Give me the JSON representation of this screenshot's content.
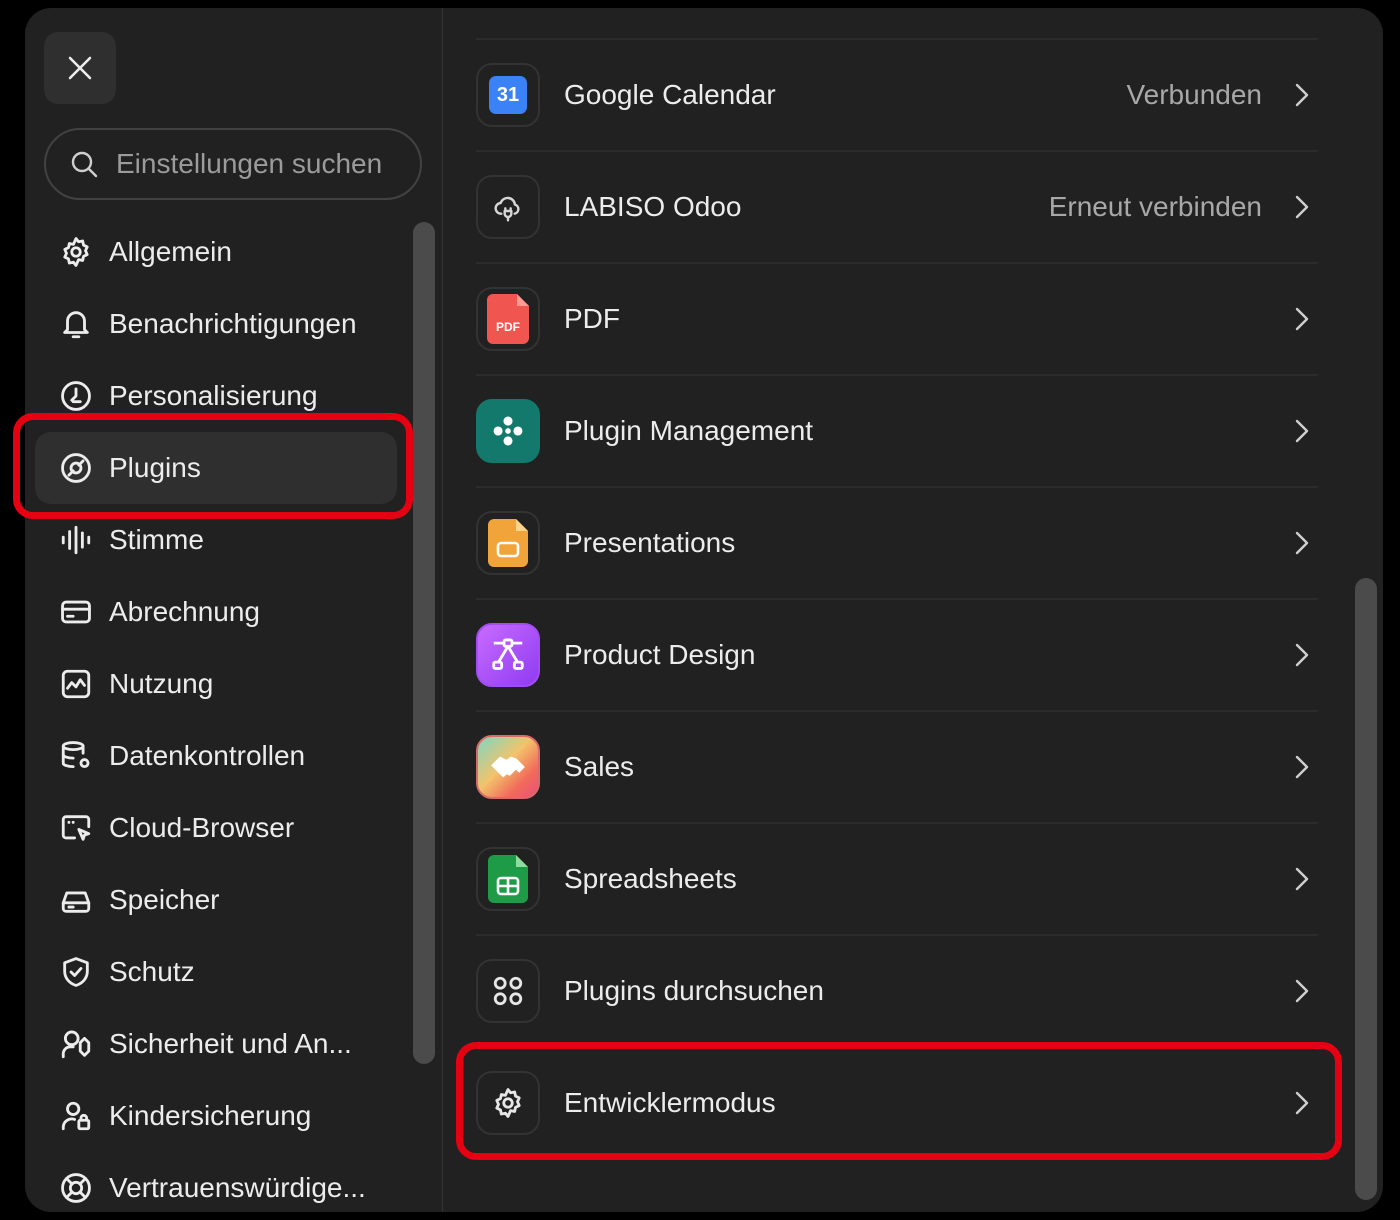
{
  "search": {
    "placeholder": "Einstellungen suchen"
  },
  "sidebar": {
    "items": [
      {
        "label": "Allgemein",
        "icon": "gear-icon"
      },
      {
        "label": "Benachrichtigungen",
        "icon": "bell-icon"
      },
      {
        "label": "Personalisierung",
        "icon": "personalize-icon"
      },
      {
        "label": "Plugins",
        "icon": "plugins-icon",
        "active": true
      },
      {
        "label": "Stimme",
        "icon": "waveform-icon"
      },
      {
        "label": "Abrechnung",
        "icon": "credit-card-icon"
      },
      {
        "label": "Nutzung",
        "icon": "usage-chart-icon"
      },
      {
        "label": "Datenkontrollen",
        "icon": "database-gear-icon"
      },
      {
        "label": "Cloud-Browser",
        "icon": "browser-cursor-icon"
      },
      {
        "label": "Speicher",
        "icon": "storage-drive-icon"
      },
      {
        "label": "Schutz",
        "icon": "shield-check-icon"
      },
      {
        "label": "Sicherheit und An...",
        "icon": "security-person-icon"
      },
      {
        "label": "Kindersicherung",
        "icon": "person-lock-icon"
      },
      {
        "label": "Vertrauenswürdige...",
        "icon": "lifebuoy-icon"
      }
    ]
  },
  "plugins": {
    "items": [
      {
        "name": "Google Calendar",
        "status": "Verbunden",
        "icon": "google-calendar-icon",
        "icon_text": "31"
      },
      {
        "name": "LABISO Odoo",
        "status": "Erneut verbinden",
        "icon": "cloud-plug-icon"
      },
      {
        "name": "PDF",
        "status": "",
        "icon": "pdf-file-icon",
        "icon_text": "PDF"
      },
      {
        "name": "Plugin Management",
        "status": "",
        "icon": "plugin-management-icon"
      },
      {
        "name": "Presentations",
        "status": "",
        "icon": "presentations-icon"
      },
      {
        "name": "Product Design",
        "status": "",
        "icon": "product-design-icon"
      },
      {
        "name": "Sales",
        "status": "",
        "icon": "handshake-icon"
      },
      {
        "name": "Spreadsheets",
        "status": "",
        "icon": "spreadsheet-icon"
      },
      {
        "name": "Plugins durchsuchen",
        "status": "",
        "icon": "grid-circles-icon"
      },
      {
        "name": "Entwicklermodus",
        "status": "",
        "icon": "gear-icon"
      }
    ]
  },
  "colors": {
    "highlight": "#e50012",
    "background": "#212121",
    "accent_teal": "#13796c"
  }
}
